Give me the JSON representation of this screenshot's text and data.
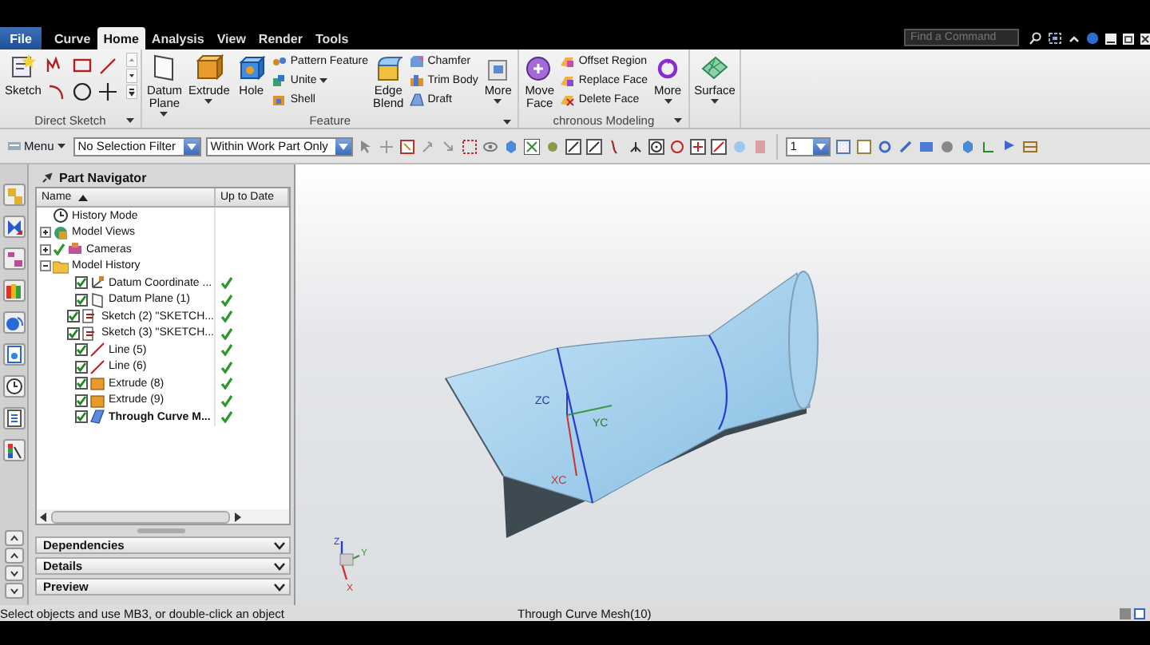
{
  "title_bar": {
    "tabs": [
      {
        "label": "File",
        "kind": "file",
        "selected": false
      },
      {
        "label": "Curve",
        "kind": "tab",
        "selected": false
      },
      {
        "label": "Home",
        "kind": "tab",
        "selected": true
      },
      {
        "label": "Analysis",
        "kind": "tab",
        "selected": false
      },
      {
        "label": "View",
        "kind": "tab",
        "selected": false
      },
      {
        "label": "Render",
        "kind": "tab",
        "selected": false
      },
      {
        "label": "Tools",
        "kind": "tab",
        "selected": false
      }
    ],
    "search": {
      "placeholder": "Find a Command"
    }
  },
  "ribbon": {
    "groups": [
      {
        "label": "Direct Sketch",
        "launcher": true,
        "items": [
          {
            "kind": "large",
            "label": "Sketch",
            "dropdown": false
          },
          {
            "kind": "sketch_grid"
          }
        ]
      },
      {
        "label": "Feature",
        "launcher": true,
        "items": [
          {
            "kind": "large",
            "label": "Datum Plane",
            "dropdown": true
          },
          {
            "kind": "large",
            "label": "Extrude",
            "dropdown": true
          },
          {
            "kind": "large",
            "label": "Hole",
            "dropdown": false
          },
          {
            "kind": "stack",
            "entries": [
              {
                "label": "Pattern Feature",
                "dropdown": false
              },
              {
                "label": "Unite",
                "dropdown": true
              },
              {
                "label": "Shell",
                "dropdown": false
              }
            ]
          },
          {
            "kind": "large",
            "label": "Edge Blend",
            "dropdown": false
          },
          {
            "kind": "stack",
            "entries": [
              {
                "label": "Chamfer",
                "dropdown": false
              },
              {
                "label": "Trim Body",
                "dropdown": false
              },
              {
                "label": "Draft",
                "dropdown": false
              }
            ]
          },
          {
            "kind": "large",
            "label": "More",
            "dropdown": true
          }
        ]
      },
      {
        "label": "chronous Modeling",
        "launcher": true,
        "items": [
          {
            "kind": "large",
            "label": "Move Face",
            "dropdown": false
          },
          {
            "kind": "stack",
            "entries": [
              {
                "label": "Offset Region",
                "dropdown": false
              },
              {
                "label": "Replace Face",
                "dropdown": false
              },
              {
                "label": "Delete Face",
                "dropdown": false
              }
            ]
          },
          {
            "kind": "large",
            "label": "More",
            "dropdown": true
          }
        ]
      },
      {
        "launcher": false,
        "items": [
          {
            "kind": "large",
            "label": "Surface",
            "dropdown": true
          }
        ]
      }
    ]
  },
  "toolbar": {
    "menu": {
      "label": "Menu"
    },
    "filters": [
      {
        "value": "No Selection Filter"
      },
      {
        "value": "Within Work Part Only"
      }
    ],
    "layer": {
      "value": "1"
    }
  },
  "navigator": {
    "title": "Part Navigator",
    "columns": [
      {
        "label": "Name",
        "sorted": true
      },
      {
        "label": "Up to Date",
        "sorted": false
      }
    ],
    "tree": [
      {
        "label": "History Mode"
      },
      {
        "label": "Model Views",
        "expanded": false
      },
      {
        "label": "Cameras",
        "expanded": false,
        "ticked": true
      },
      {
        "label": "Model History",
        "expanded": true,
        "children": [
          {
            "label": "Datum Coordinate ...",
            "checked": true,
            "up_to_date": true,
            "current": false
          },
          {
            "label": "Datum Plane (1)",
            "checked": true,
            "up_to_date": true,
            "current": false
          },
          {
            "label": "Sketch (2) \"SKETCH...",
            "checked": true,
            "up_to_date": true,
            "current": false
          },
          {
            "label": "Sketch (3) \"SKETCH...",
            "checked": true,
            "up_to_date": true,
            "current": false
          },
          {
            "label": "Line (5)",
            "checked": true,
            "up_to_date": true,
            "current": false
          },
          {
            "label": "Line (6)",
            "checked": true,
            "up_to_date": true,
            "current": false
          },
          {
            "label": "Extrude (8)",
            "checked": true,
            "up_to_date": true,
            "current": false
          },
          {
            "label": "Extrude (9)",
            "checked": true,
            "up_to_date": true,
            "current": false
          },
          {
            "label": "Through Curve M...",
            "checked": true,
            "up_to_date": true,
            "current": true
          }
        ]
      }
    ],
    "panels": [
      {
        "label": "Dependencies",
        "expanded": false
      },
      {
        "label": "Details",
        "expanded": false
      },
      {
        "label": "Preview",
        "expanded": false
      }
    ]
  },
  "viewport": {
    "wcs_labels": [
      "ZC",
      "YC",
      "XC"
    ],
    "triad_labels": [
      "Z",
      "Y",
      "X"
    ]
  },
  "status_bar": {
    "prompt": "Select objects and use MB3, or double-click an object",
    "message": "Through Curve Mesh(10)"
  }
}
